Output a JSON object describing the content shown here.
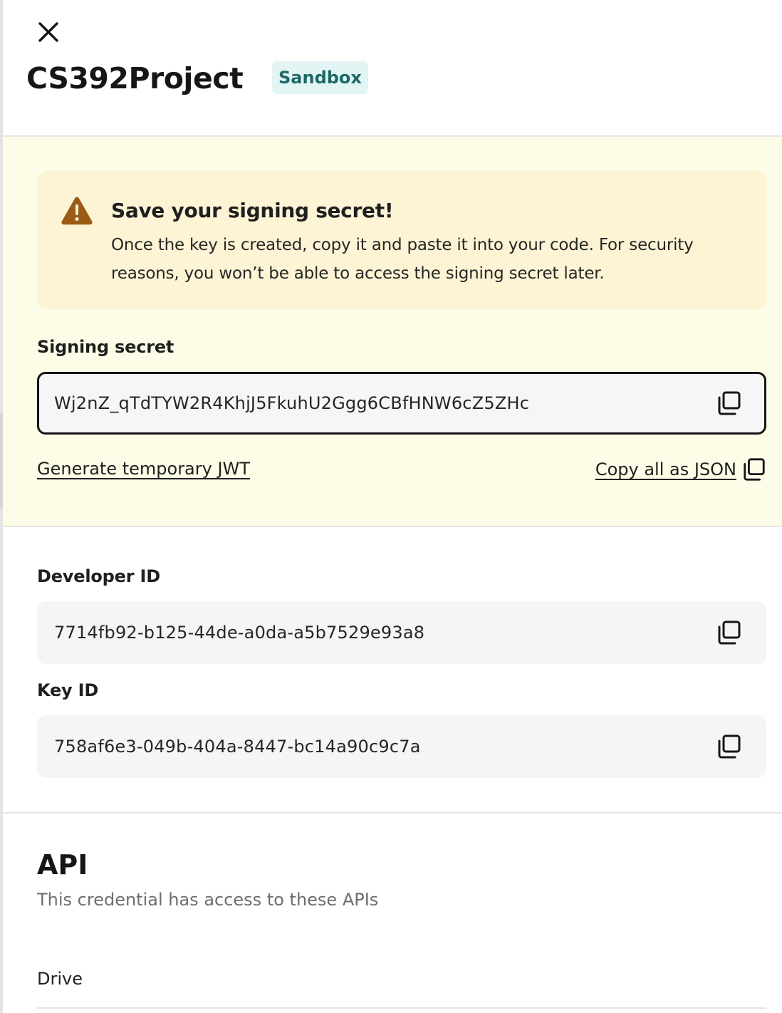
{
  "header": {
    "title": "CS392Project",
    "badge": "Sandbox",
    "close_icon": "close-icon"
  },
  "warning": {
    "icon": "warning-icon",
    "title": "Save your signing secret!",
    "body": "Once the key is created, copy it and paste it into your code. For security reasons, you won’t be able to access the signing secret later."
  },
  "signing_secret": {
    "label": "Signing secret",
    "value": "Wj2nZ_qTdTYW2R4KhjJ5FkuhU2Ggg6CBfHNW6cZ5ZHc",
    "copy_icon": "copy-icon"
  },
  "links": {
    "generate_jwt": "Generate temporary JWT",
    "copy_json": "Copy all as JSON"
  },
  "developer_id": {
    "label": "Developer ID",
    "value": "7714fb92-b125-44de-a0da-a5b7529e93a8"
  },
  "key_id": {
    "label": "Key ID",
    "value": "758af6e3-049b-404a-8447-bc14a90c9c7a"
  },
  "api": {
    "heading": "API",
    "subtitle": "This credential has access to these APIs",
    "items": [
      "Drive"
    ]
  },
  "colors": {
    "highlight_bg": "#fdfce6",
    "warning_bg": "#fcf4d4",
    "warning_icon": "#9b5b16",
    "badge_bg": "#e3f4f4",
    "badge_text": "#1c6966"
  }
}
